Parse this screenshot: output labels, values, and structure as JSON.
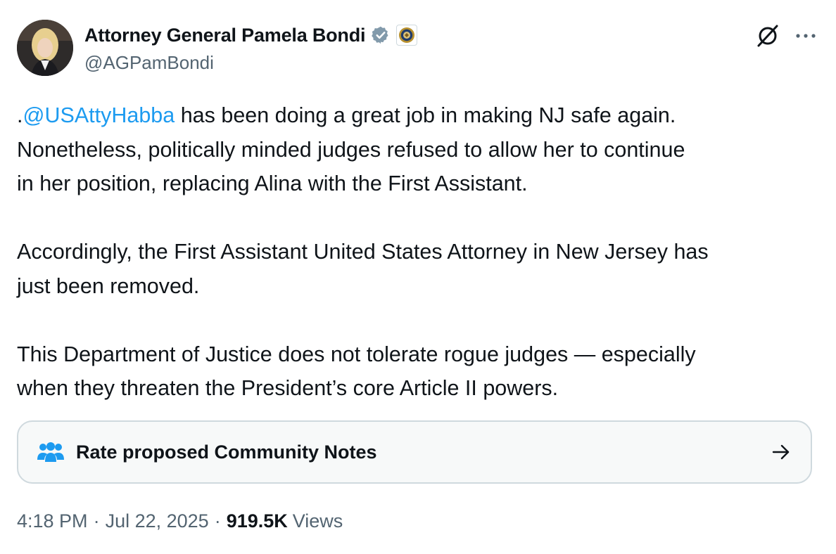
{
  "author": {
    "display_name": "Attorney General Pamela Bondi",
    "handle": "@AGPamBondi",
    "verified_icon": "verified-badge-icon",
    "affiliation_icon": "doj-seal-icon"
  },
  "actions": {
    "grok_icon": "grok-icon",
    "more_icon": "more-icon"
  },
  "tweet": {
    "line1_prefix": ".",
    "mention": "@USAttyHabba",
    "line1_suffix": " has been doing a great job in making NJ safe again.",
    "line2": "Nonetheless, politically minded judges refused to allow her to continue",
    "line3": "in her position, replacing Alina with the First Assistant.",
    "line4": "Accordingly, the First Assistant United States Attorney in New Jersey has",
    "line5": "just been removed.",
    "line6": "This Department of Justice does not tolerate rogue judges — especially",
    "line7": "when they threaten the President’s core Article II powers."
  },
  "community_notes": {
    "label": "Rate proposed Community Notes",
    "icon": "people-icon",
    "arrow": "arrow-right-icon"
  },
  "meta": {
    "time": "4:18 PM",
    "separator": "·",
    "date": "Jul 22, 2025",
    "views_count": "919.5K",
    "views_label": "Views"
  },
  "colors": {
    "link": "#1d9bf0",
    "secondary_text": "#536471",
    "verified": "#829aab"
  }
}
